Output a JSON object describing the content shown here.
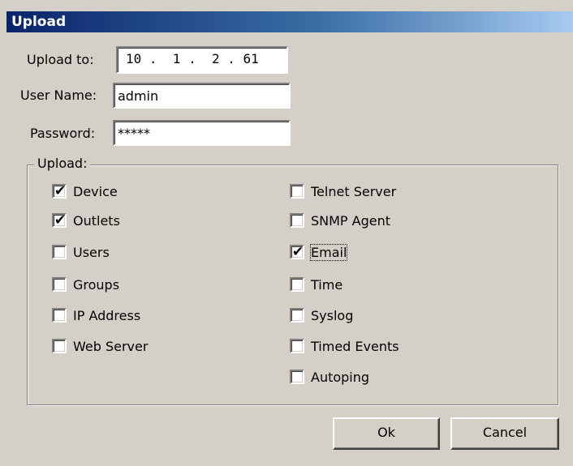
{
  "window": {
    "title": "Upload"
  },
  "form": {
    "upload_to_label": "Upload to:",
    "upload_to_value": "10 .  1 .  2 . 61",
    "username_label": "User Name:",
    "username_value": "admin",
    "password_label": "Password:",
    "password_value": "*****"
  },
  "upload_group": {
    "legend": "Upload:",
    "left_items": [
      {
        "label": "Device",
        "checked": true
      },
      {
        "label": "Outlets",
        "checked": true
      },
      {
        "label": "Users",
        "checked": false
      },
      {
        "label": "Groups",
        "checked": false
      },
      {
        "label": "IP Address",
        "checked": false
      },
      {
        "label": "Web Server",
        "checked": false
      }
    ],
    "right_items": [
      {
        "label": "Telnet Server",
        "checked": false
      },
      {
        "label": "SNMP Agent",
        "checked": false
      },
      {
        "label": "Email",
        "checked": true
      },
      {
        "label": "Time",
        "checked": false
      },
      {
        "label": "Syslog",
        "checked": false
      },
      {
        "label": "Timed Events",
        "checked": false
      },
      {
        "label": "Autoping",
        "checked": false
      }
    ]
  },
  "buttons": {
    "ok_label": "Ok",
    "cancel_label": "Cancel"
  },
  "colors": {
    "title_bar_start": "#0a246a",
    "title_bar_end": "#a6caf0",
    "dialog_face": "#d4d0c8"
  },
  "icons": {
    "check": "check-mark-icon"
  }
}
